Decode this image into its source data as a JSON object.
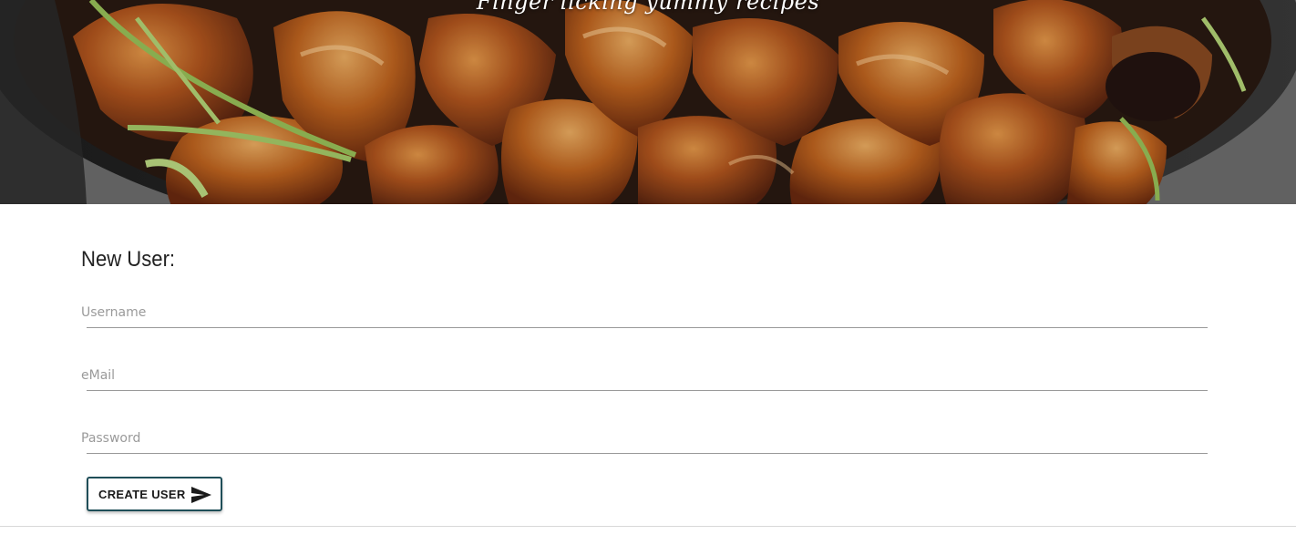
{
  "hero": {
    "tagline": "Finger licking yummy recipes",
    "image": "roast-chicken-skillet-photo"
  },
  "form": {
    "title": "New User:",
    "fields": {
      "username": {
        "placeholder": "Username",
        "value": ""
      },
      "email": {
        "placeholder": "eMail",
        "value": ""
      },
      "password": {
        "placeholder": "Password",
        "value": ""
      }
    },
    "submit": {
      "label": "CREATE USER",
      "icon": "send-icon"
    }
  },
  "colors": {
    "button_border": "#1f4e58",
    "underline": "#9a9a9a",
    "title_text": "#222222"
  }
}
